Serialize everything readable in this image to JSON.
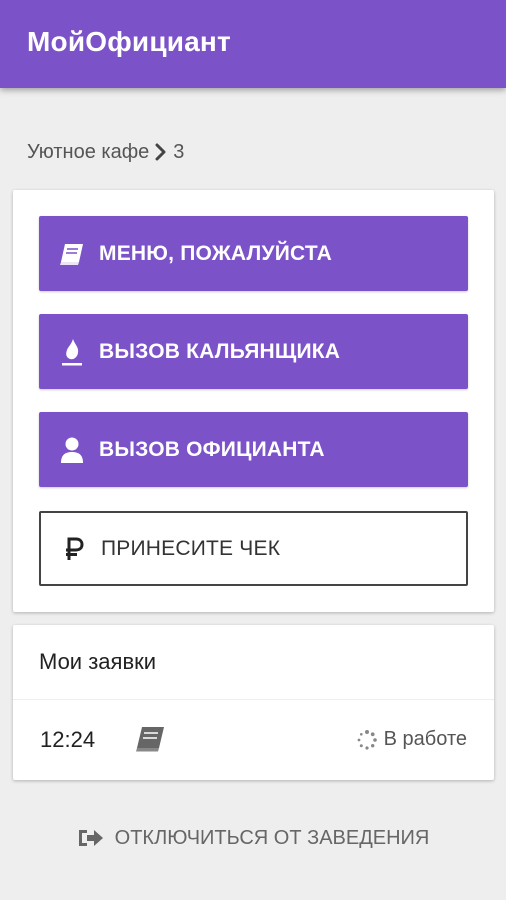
{
  "app": {
    "title": "МойОфициант",
    "accent": "#7b52c7"
  },
  "breadcrumb": {
    "venue": "Уютное кафе",
    "table": "3"
  },
  "actions": {
    "menu": {
      "label": "МЕНЮ, ПОЖАЛУЙСТА",
      "icon": "book-icon"
    },
    "hookah": {
      "label": "ВЫЗОВ КАЛЬЯНЩИКА",
      "icon": "flame-icon"
    },
    "waiter": {
      "label": "ВЫЗОВ ОФИЦИАНТА",
      "icon": "person-icon"
    },
    "bill": {
      "label": "ПРИНЕСИТЕ ЧЕК",
      "icon": "ruble-icon"
    }
  },
  "orders": {
    "title": "Мои заявки",
    "items": [
      {
        "time": "12:24",
        "icon": "book-icon",
        "status": "В работе",
        "status_icon": "spinner-icon"
      }
    ]
  },
  "footer": {
    "disconnect_label": "ОТКЛЮЧИТЬСЯ ОТ ЗАВЕДЕНИЯ",
    "icon": "sign-out-icon"
  }
}
